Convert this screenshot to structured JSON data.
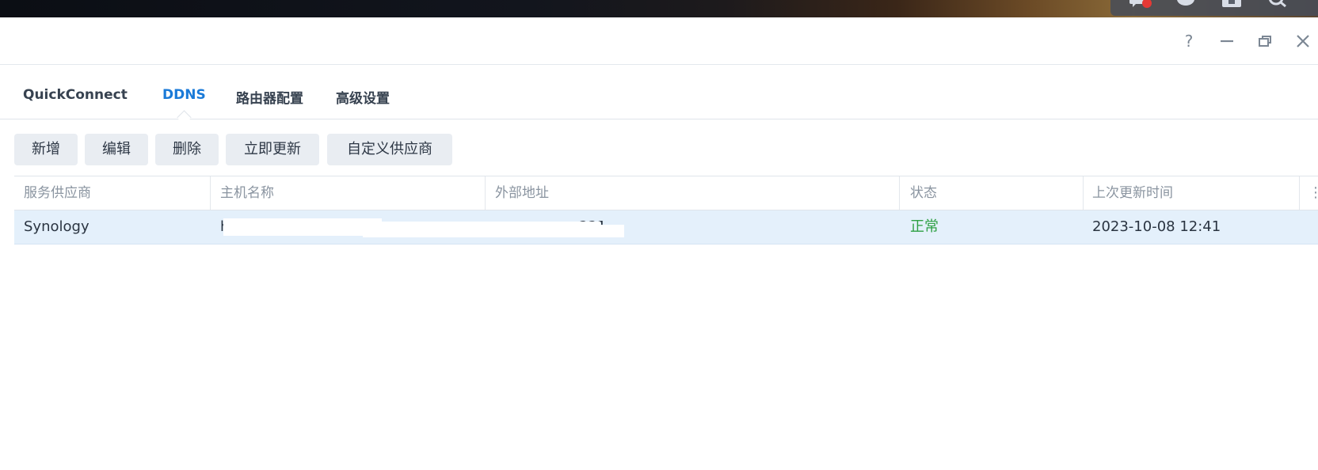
{
  "tray": {
    "icons": [
      "chat-icon",
      "user-icon",
      "widget-icon",
      "search-icon"
    ]
  },
  "window_controls": {
    "help": "?",
    "minimize": "—",
    "restore": "❐",
    "close": "✕"
  },
  "tabs": [
    {
      "label": "QuickConnect",
      "active": false
    },
    {
      "label": "DDNS",
      "active": true
    },
    {
      "label": "路由器配置",
      "active": false
    },
    {
      "label": "高级设置",
      "active": false
    }
  ],
  "toolbar": {
    "add": "新增",
    "edit": "编辑",
    "delete": "删除",
    "update_now": "立即更新",
    "custom_provider": "自定义供应商"
  },
  "table": {
    "columns": [
      "服务供应商",
      "主机名称",
      "外部地址",
      "状态",
      "上次更新时间"
    ],
    "rows": [
      {
        "provider": "Synology",
        "hostname": "h",
        "external_address": "221",
        "status": "正常",
        "last_update": "2023-10-08 12:41"
      }
    ]
  },
  "colors": {
    "accent": "#1a7ad8",
    "status_ok": "#2ea043",
    "selected_row": "#e4f0fb"
  }
}
